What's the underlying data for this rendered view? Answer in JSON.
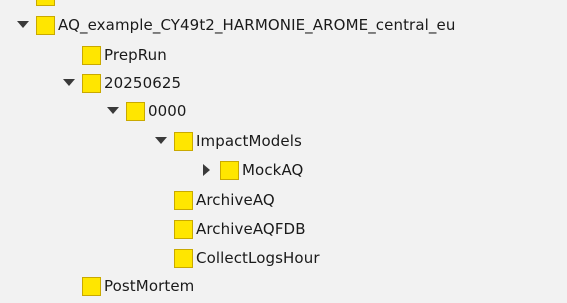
{
  "tree": {
    "nodes": [
      {
        "label": "AQ_example_CY49t2_HARMONIE_AROME_central_eu",
        "toggle": "expanded"
      },
      {
        "label": "PrepRun",
        "toggle": "none"
      },
      {
        "label": "20250625",
        "toggle": "expanded"
      },
      {
        "label": "0000",
        "toggle": "expanded"
      },
      {
        "label": "ImpactModels",
        "toggle": "expanded"
      },
      {
        "label": "MockAQ",
        "toggle": "collapsed"
      },
      {
        "label": "ArchiveAQ",
        "toggle": "none"
      },
      {
        "label": "ArchiveAQFDB",
        "toggle": "none"
      },
      {
        "label": "CollectLogsHour",
        "toggle": "none"
      },
      {
        "label": "PostMortem",
        "toggle": "none"
      }
    ]
  },
  "colors": {
    "background": "#f2f2f2",
    "folder": "#ffe600",
    "folder_border": "#c9a900",
    "text": "#1a1a1a",
    "toggle": "#3a3a3a"
  },
  "icons": {
    "expanded": "triangle-down-icon",
    "collapsed": "triangle-right-icon",
    "folder": "folder-icon"
  }
}
